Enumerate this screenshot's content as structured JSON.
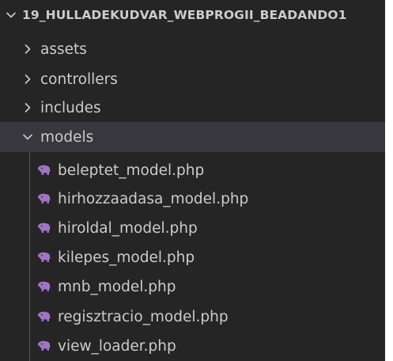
{
  "explorer": {
    "root": {
      "label": "19_HULLADEKUDVAR_WEBPROGII_BEADANDO1",
      "chevron": "chevron-down-icon"
    },
    "folders": [
      {
        "label": "assets",
        "chevron": "chevron-right-icon"
      },
      {
        "label": "controllers",
        "chevron": "chevron-right-icon"
      },
      {
        "label": "includes",
        "chevron": "chevron-right-icon"
      },
      {
        "label": "models",
        "chevron": "chevron-down-icon"
      }
    ],
    "files": [
      {
        "label": "beleptet_model.php",
        "icon": "php-elephant-icon"
      },
      {
        "label": "hirhozzaadasa_model.php",
        "icon": "php-elephant-icon"
      },
      {
        "label": "hiroldal_model.php",
        "icon": "php-elephant-icon"
      },
      {
        "label": "kilepes_model.php",
        "icon": "php-elephant-icon"
      },
      {
        "label": "mnb_model.php",
        "icon": "php-elephant-icon"
      },
      {
        "label": "regisztracio_model.php",
        "icon": "php-elephant-icon"
      },
      {
        "label": "view_loader.php",
        "icon": "php-elephant-icon"
      }
    ],
    "colors": {
      "background": "#252526",
      "text": "#cccccc",
      "selected_row": "#37373d",
      "php_icon": "#a074c4"
    }
  }
}
